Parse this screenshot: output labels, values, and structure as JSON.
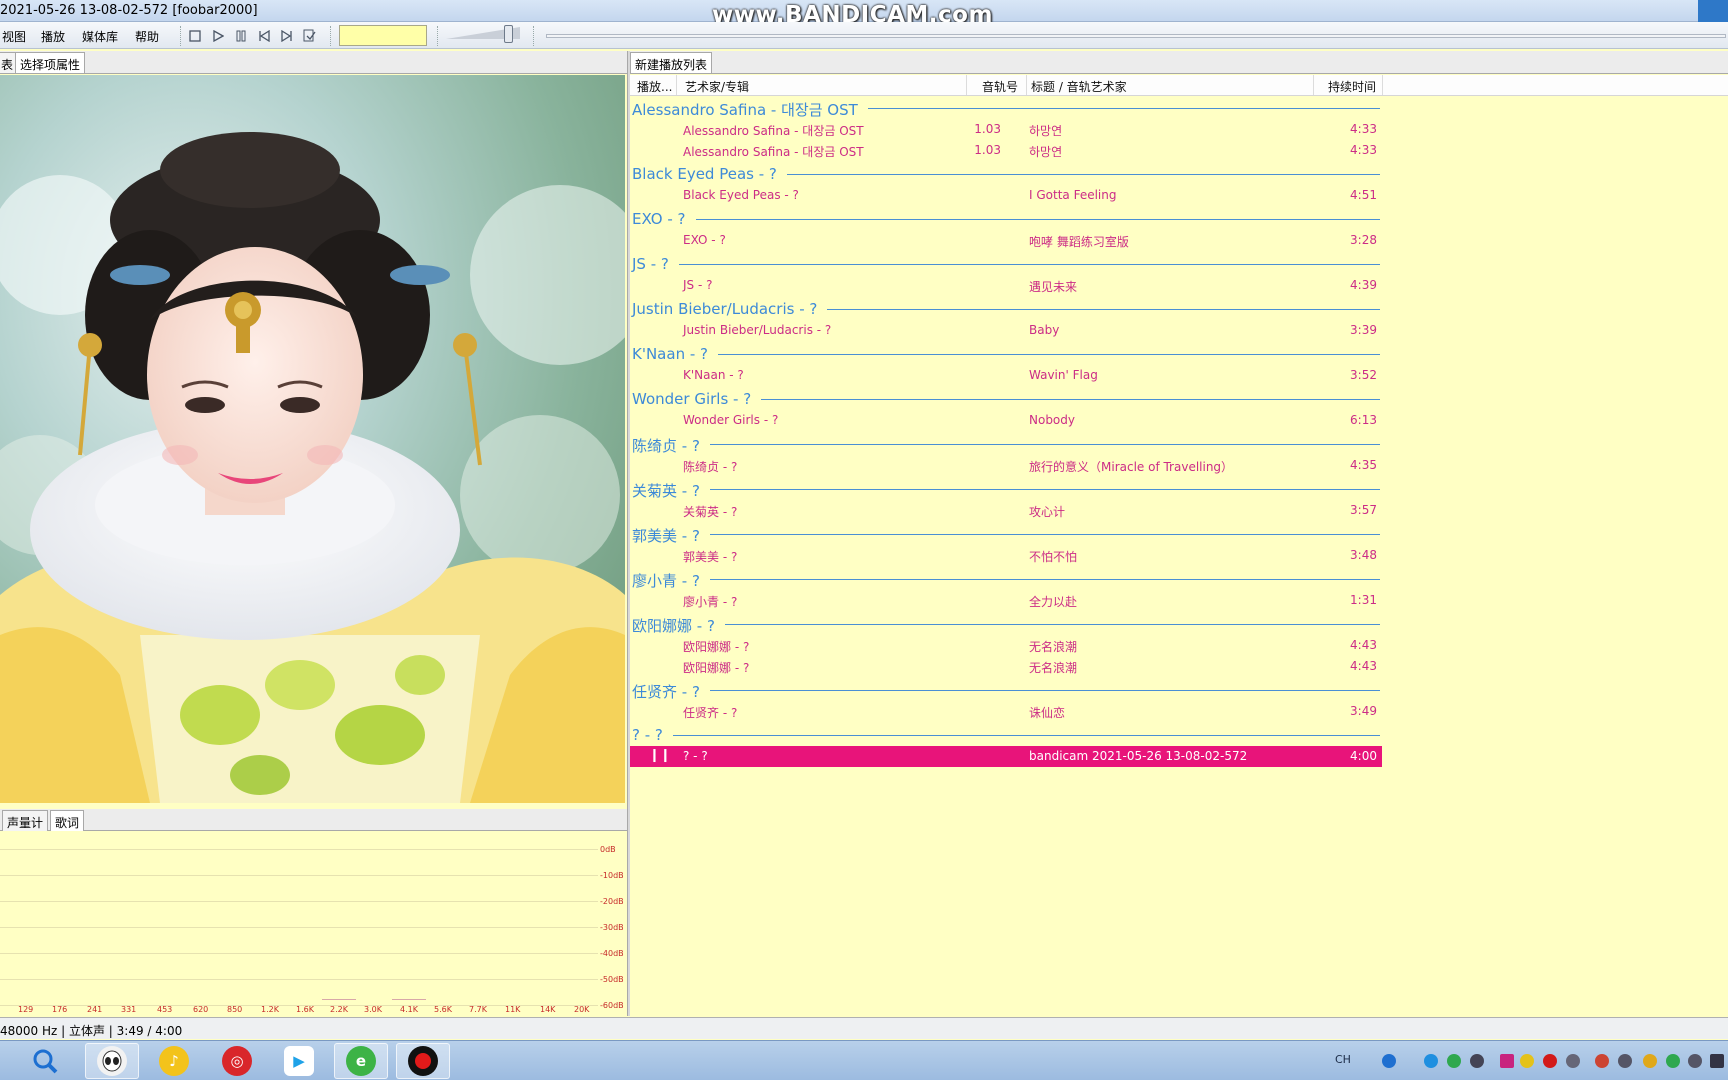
{
  "window": {
    "title": "2021-05-26 13-08-02-572  [foobar2000]",
    "watermark": "www.BANDICAM.com"
  },
  "menu": [
    "视图",
    "播放",
    "媒体库",
    "帮助"
  ],
  "toolbar": {
    "buttons": [
      "stop-icon",
      "play-icon",
      "pause-icon",
      "previous-icon",
      "next-icon",
      "random-icon"
    ],
    "volume_level": 0.85
  },
  "left_tabs": [
    "表",
    "选择项属性"
  ],
  "vis_tabs": [
    "声量计",
    "歌词"
  ],
  "spectrum": {
    "db_labels": [
      "0dB",
      "-10dB",
      "-20dB",
      "-30dB",
      "-40dB",
      "-50dB",
      "-60dB"
    ],
    "freq_labels": [
      "129",
      "176",
      "241",
      "331",
      "453",
      "620",
      "850",
      "1.2K",
      "1.6K",
      "2.2K",
      "3.0K",
      "4.1K",
      "5.6K",
      "7.7K",
      "11K",
      "14K",
      "20K"
    ]
  },
  "playlist": {
    "tab": "新建播放列表",
    "columns": {
      "playing": "播放...",
      "artist_album": "艺术家/专辑",
      "track_no": "音轨号",
      "title": "标题 / 音轨艺术家",
      "duration": "持续时间"
    },
    "groups": [
      {
        "name": "Alessandro Safina - 대장금 OST",
        "tracks": [
          {
            "artist": "Alessandro Safina - 대장금 OST",
            "num": "1.03",
            "title": "하망연",
            "dur": "4:33"
          },
          {
            "artist": "Alessandro Safina - 대장금 OST",
            "num": "1.03",
            "title": "하망연",
            "dur": "4:33"
          }
        ]
      },
      {
        "name": "Black Eyed Peas - ?",
        "tracks": [
          {
            "artist": "Black Eyed Peas - ?",
            "num": "",
            "title": "I Gotta Feeling",
            "dur": "4:51"
          }
        ]
      },
      {
        "name": "EXO - ?",
        "tracks": [
          {
            "artist": "EXO - ?",
            "num": "",
            "title": "咆哮 舞蹈练习室版",
            "dur": "3:28"
          }
        ]
      },
      {
        "name": "JS - ?",
        "tracks": [
          {
            "artist": "JS - ?",
            "num": "",
            "title": "遇见未来",
            "dur": "4:39"
          }
        ]
      },
      {
        "name": "Justin Bieber/Ludacris - ?",
        "tracks": [
          {
            "artist": "Justin Bieber/Ludacris - ?",
            "num": "",
            "title": "Baby",
            "dur": "3:39"
          }
        ]
      },
      {
        "name": "K'Naan - ?",
        "tracks": [
          {
            "artist": "K'Naan - ?",
            "num": "",
            "title": "Wavin' Flag",
            "dur": "3:52"
          }
        ]
      },
      {
        "name": "Wonder Girls - ?",
        "tracks": [
          {
            "artist": "Wonder Girls - ?",
            "num": "",
            "title": "Nobody",
            "dur": "6:13"
          }
        ]
      },
      {
        "name": "陈绮贞 - ?",
        "tracks": [
          {
            "artist": "陈绮贞 - ?",
            "num": "",
            "title": "旅行的意义（Miracle of Travelling）",
            "dur": "4:35"
          }
        ]
      },
      {
        "name": "关菊英 - ?",
        "tracks": [
          {
            "artist": "关菊英 - ?",
            "num": "",
            "title": "攻心计",
            "dur": "3:57"
          }
        ]
      },
      {
        "name": "郭美美 - ?",
        "tracks": [
          {
            "artist": "郭美美 - ?",
            "num": "",
            "title": "不怕不怕",
            "dur": "3:48"
          }
        ]
      },
      {
        "name": "廖小青 - ?",
        "tracks": [
          {
            "artist": "廖小青 - ?",
            "num": "",
            "title": "全力以赴",
            "dur": "1:31"
          }
        ]
      },
      {
        "name": "欧阳娜娜 - ?",
        "tracks": [
          {
            "artist": "欧阳娜娜 - ?",
            "num": "",
            "title": "无名浪潮",
            "dur": "4:43"
          },
          {
            "artist": "欧阳娜娜 - ?",
            "num": "",
            "title": "无名浪潮",
            "dur": "4:43"
          }
        ]
      },
      {
        "name": "任贤齐 - ?",
        "tracks": [
          {
            "artist": "任贤齐 - ?",
            "num": "",
            "title": "诛仙恋",
            "dur": "3:49"
          }
        ]
      },
      {
        "name": "? - ?",
        "tracks": [
          {
            "artist": "? - ?",
            "num": "",
            "title": "bandicam 2021-05-26 13-08-02-572",
            "dur": "4:00",
            "playing": true
          }
        ]
      }
    ]
  },
  "status": "48000 Hz | 立体声 | 3:49 / 4:00",
  "taskbar": {
    "apps": [
      "search-app",
      "kugou-app",
      "kuwo-app",
      "netease-music-app",
      "youku-app",
      "browser-app",
      "bandicam-app"
    ],
    "tray_text": "CH"
  },
  "colors": {
    "background": "#ffffc4",
    "group_text": "#3d8ad8",
    "track_text": "#cc2c86",
    "playing_row": "#e8147a"
  }
}
